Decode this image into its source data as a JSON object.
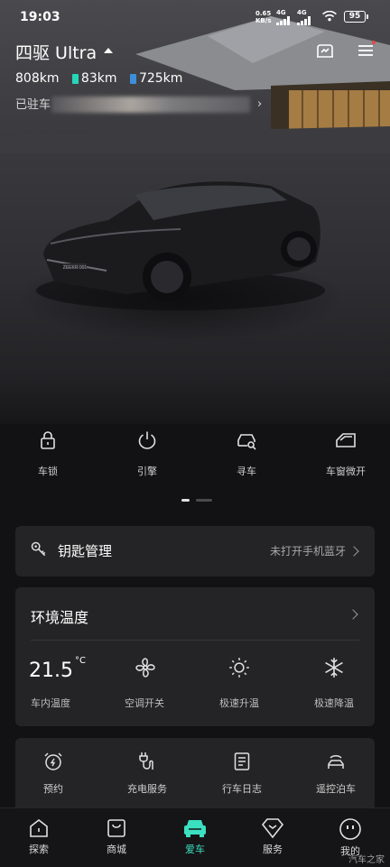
{
  "status_bar": {
    "time": "19:03",
    "net_speed_value": "0.65",
    "net_speed_unit": "KB/s",
    "net_type_1": "4G",
    "net_type_2": "4G",
    "battery": "95"
  },
  "header": {
    "car_title": "四驱 Ultra",
    "total_range": "808km",
    "battery_range_1": "83km",
    "battery_range_1_color": "#27d6b8",
    "battery_range_2": "725km",
    "battery_range_2_color": "#3d8fdc",
    "location_prefix": "已驻车"
  },
  "car_logo_text": "ZEEKR 001",
  "quick_controls": [
    {
      "label": "车锁",
      "icon": "lock-icon"
    },
    {
      "label": "引擎",
      "icon": "power-icon"
    },
    {
      "label": "寻车",
      "icon": "find-car-icon"
    },
    {
      "label": "车窗微开",
      "icon": "window-icon"
    }
  ],
  "key_card": {
    "title": "钥匙管理",
    "status": "未打开手机蓝牙",
    "icon": "key-icon"
  },
  "environment": {
    "title": "环境温度",
    "temperature": "21.5",
    "temperature_unit": "°C",
    "temperature_label": "车内温度",
    "controls": [
      {
        "label": "空调开关",
        "icon": "fan-icon"
      },
      {
        "label": "极速升温",
        "icon": "sun-icon"
      },
      {
        "label": "极速降温",
        "icon": "snowflake-icon"
      }
    ]
  },
  "services": [
    {
      "label": "预约",
      "icon": "alarm-clock-icon"
    },
    {
      "label": "充电服务",
      "icon": "charging-plug-icon"
    },
    {
      "label": "行车日志",
      "icon": "logbook-icon"
    },
    {
      "label": "遥控泊车",
      "icon": "remote-parking-icon"
    }
  ],
  "bottom_nav": [
    {
      "label": "探索",
      "icon": "home-icon",
      "active": false
    },
    {
      "label": "商城",
      "icon": "shopping-bag-icon",
      "active": false
    },
    {
      "label": "爱车",
      "icon": "car-icon",
      "active": true
    },
    {
      "label": "服务",
      "icon": "diamond-icon",
      "active": false
    },
    {
      "label": "我的",
      "icon": "smiley-icon",
      "active": false
    }
  ],
  "colors": {
    "accent": "#3be0c0",
    "background": "#121214",
    "card": "#242426"
  },
  "watermark": "汽车之家"
}
